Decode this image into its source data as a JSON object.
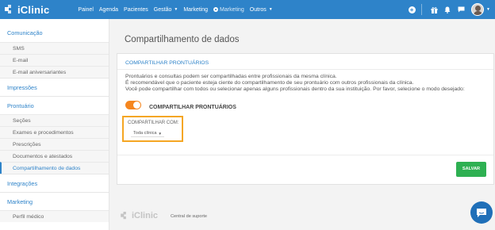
{
  "app": {
    "logo_text": "iClinic",
    "brand_color": "#2e83c9",
    "accent_color": "#f5861f",
    "success_color": "#2eb052"
  },
  "topnav": {
    "items": [
      {
        "label": "Painel"
      },
      {
        "label": "Agenda"
      },
      {
        "label": "Pacientes"
      },
      {
        "label": "Gestão",
        "has_caret": true
      },
      {
        "label": "Marketing"
      },
      {
        "label": "Marketing",
        "icon": "marketing-dot-icon"
      },
      {
        "label": "Outros",
        "has_caret": true
      }
    ],
    "right_icons": [
      "plus-circle-icon",
      "gift-icon",
      "bell-icon",
      "chat-icon",
      "avatar"
    ]
  },
  "sidebar": {
    "sections": [
      {
        "title": "Comunicação",
        "items": [
          "SMS",
          "E-mail",
          "E-mail aniversariantes"
        ]
      },
      {
        "title": "Impressões",
        "items": []
      },
      {
        "title": "Prontuário",
        "items": [
          "Seções",
          "Exames e procedimentos",
          "Prescrições",
          "Documentos e atestados",
          "Compartilhamento de dados"
        ]
      },
      {
        "title": "Integrações",
        "items": []
      },
      {
        "title": "Marketing",
        "items": [
          "Perfil médico"
        ]
      }
    ],
    "active_item": "Compartilhamento de dados"
  },
  "main": {
    "page_title": "Compartilhamento de dados",
    "card": {
      "title": "COMPARTILHAR PRONTUÁRIOS",
      "paragraphs": [
        "Prontuários e consultas podem ser compartilhadas entre profissionais da mesma clínica.",
        "É recomendável que o paciente esteja ciente do compartilhamento de seu prontuário com outros profissionais da clínica.",
        "Você pode compartilhar com todos ou selecionar apenas alguns profissionais dentro da sua instituição. Por favor, selecione o modo desejado:"
      ],
      "toggle_label": "COMPARTILHAR PRONTUÁRIOS",
      "toggle_on": true,
      "share_with_label": "COMPARTILHAR COM:",
      "share_with_value": "Toda clínica",
      "save_label": "SALVAR"
    }
  },
  "footer": {
    "logo_text": "iClinic",
    "support_link": "Central de suporte"
  }
}
